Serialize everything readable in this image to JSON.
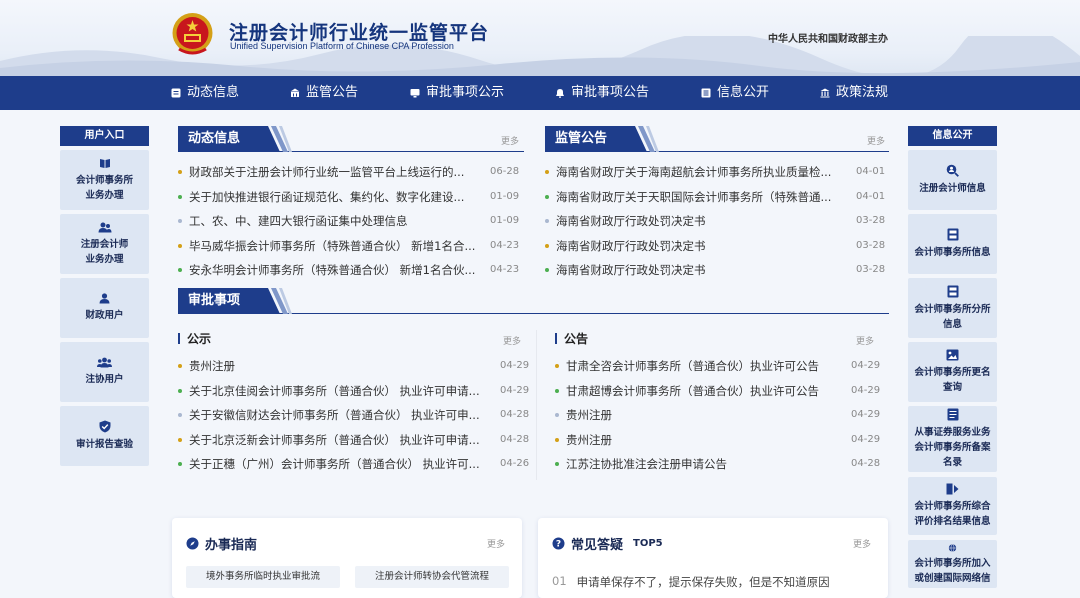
{
  "header": {
    "title": "注册会计师行业统一监管平台",
    "subtitle": "Unified Supervision Platform of Chinese CPA Profession",
    "host": "中华人民共和国财政部主办"
  },
  "nav": [
    {
      "label": "动态信息",
      "icon": "news-icon"
    },
    {
      "label": "监管公告",
      "icon": "bank-icon"
    },
    {
      "label": "审批事项公示",
      "icon": "monitor-icon"
    },
    {
      "label": "审批事项公告",
      "icon": "bell-icon"
    },
    {
      "label": "信息公开",
      "icon": "list-icon"
    },
    {
      "label": "政策法规",
      "icon": "building-icon"
    }
  ],
  "left_sidebar": {
    "title": "用户入口",
    "items": [
      {
        "label": "会计师事务所\n业务办理",
        "icon": "book-icon"
      },
      {
        "label": "注册会计师\n业务办理",
        "icon": "users-icon"
      },
      {
        "label": "财政用户",
        "icon": "user-icon"
      },
      {
        "label": "注协用户",
        "icon": "group-icon"
      },
      {
        "label": "审计报告查验",
        "icon": "shield-check-icon"
      }
    ]
  },
  "right_sidebar": {
    "title": "信息公开",
    "items": [
      {
        "label": "注册会计师信息",
        "icon": "search-user-icon"
      },
      {
        "label": "会计师事务所信息",
        "icon": "cabinet-icon"
      },
      {
        "label": "会计师事务所分所\n信息",
        "icon": "cabinet-icon"
      },
      {
        "label": "会计师事务所更名\n查询",
        "icon": "image-icon"
      },
      {
        "label": "从事证券服务业务\n会计师事务所备案\n名录",
        "icon": "document-icon"
      },
      {
        "label": "会计师事务所综合\n评价排名结果信息",
        "icon": "chart-icon"
      },
      {
        "label": "会计师事务所加入\n或创建国际网络信",
        "icon": "globe-icon"
      }
    ]
  },
  "dynamic": {
    "title": "动态信息",
    "more": "更多",
    "items": [
      {
        "text": "财政部关于注册会计师行业统一监管平台上线运行的...",
        "date": "06-28"
      },
      {
        "text": "关于加快推进银行函证规范化、集约化、数字化建设...",
        "date": "01-09"
      },
      {
        "text": "工、农、中、建四大银行函证集中处理信息",
        "date": "01-09"
      },
      {
        "text": "毕马威华振会计师事务所（特殊普通合伙） 新增1名合...",
        "date": "04-23"
      },
      {
        "text": "安永华明会计师事务所（特殊普通合伙） 新增1名合伙...",
        "date": "04-23"
      }
    ]
  },
  "supervision": {
    "title": "监管公告",
    "more": "更多",
    "items": [
      {
        "text": "海南省财政厅关于海南超航会计师事务所执业质量检...",
        "date": "04-01"
      },
      {
        "text": "海南省财政厅关于天职国际会计师事务所（特殊普通...",
        "date": "04-01"
      },
      {
        "text": "海南省财政厅行政处罚决定书",
        "date": "03-28"
      },
      {
        "text": "海南省财政厅行政处罚决定书",
        "date": "03-28"
      },
      {
        "text": "海南省财政厅行政处罚决定书",
        "date": "03-28"
      }
    ]
  },
  "approval": {
    "title": "审批事项",
    "publicity": {
      "title": "公示",
      "more": "更多",
      "items": [
        {
          "text": "贵州注册",
          "date": "04-29"
        },
        {
          "text": "关于北京佳阅会计师事务所（普通合伙） 执业许可申请...",
          "date": "04-29"
        },
        {
          "text": "关于安徽信财达会计师事务所（普通合伙） 执业许可申...",
          "date": "04-28"
        },
        {
          "text": "关于北京泛新会计师事务所（普通合伙） 执业许可申请...",
          "date": "04-28"
        },
        {
          "text": "关于正穗（广州）会计师事务所（普通合伙） 执业许可...",
          "date": "04-26"
        }
      ]
    },
    "announcement": {
      "title": "公告",
      "more": "更多",
      "items": [
        {
          "text": "甘肃全咨会计师事务所（普通合伙）执业许可公告",
          "date": "04-29"
        },
        {
          "text": "甘肃超博会计师事务所（普通合伙）执业许可公告",
          "date": "04-29"
        },
        {
          "text": "贵州注册",
          "date": "04-29"
        },
        {
          "text": "贵州注册",
          "date": "04-29"
        },
        {
          "text": "江苏注协批准注会注册申请公告",
          "date": "04-28"
        }
      ]
    }
  },
  "guide": {
    "title": "办事指南",
    "more": "更多",
    "buttons": [
      "境外事务所临时执业审批流",
      "注册会计师转协会代管流程"
    ]
  },
  "faq": {
    "title": "常见答疑",
    "badge": "TOP5",
    "more": "更多",
    "first": {
      "num": "01",
      "text": "申请单保存不了，提示保存失败，但是不知道原因"
    }
  },
  "colors": {
    "primary": "#1e3d8b",
    "bullet_a": "#d4a017",
    "bullet_b": "#4caf50",
    "bullet_c": "#aab8d0",
    "side_card": "#dde6f3"
  }
}
